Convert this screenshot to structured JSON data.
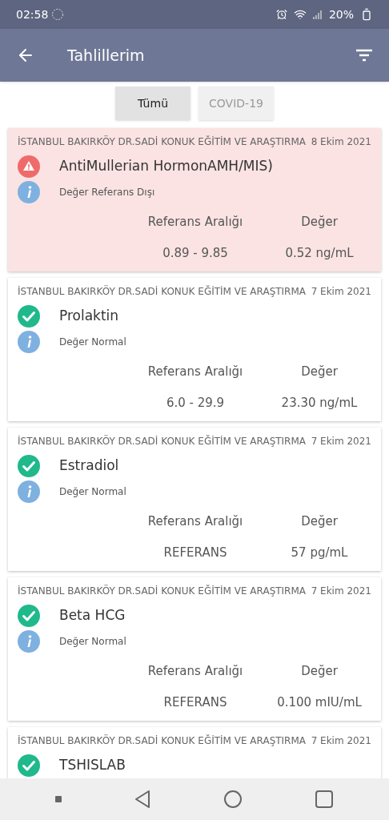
{
  "status_bar": {
    "time": "02:58",
    "battery": "20%"
  },
  "app_bar": {
    "title": "Tahlillerim"
  },
  "tabs": [
    {
      "label": "Tümü",
      "selected": true
    },
    {
      "label": "COVID-19",
      "selected": false
    }
  ],
  "results": [
    {
      "hospital": "İSTANBUL BAKIRKÖY DR.SADİ KONUK EĞİTİM VE ARAŞTIRMA",
      "date": "8 Ekim 2021",
      "test": "AntiMullerian HormonAMH/MIS)",
      "kind": "abnormal",
      "note": "Değer Referans Dışı",
      "range_label": "Referans Aralığı",
      "value_label": "Değer",
      "range": "0.89 - 9.85",
      "value": "0.52 ng/mL"
    },
    {
      "hospital": "İSTANBUL BAKIRKÖY DR.SADİ KONUK EĞİTİM VE ARAŞTIRMA",
      "date": "7 Ekim 2021",
      "test": "Prolaktin",
      "kind": "normal",
      "note": "Değer Normal",
      "range_label": "Referans Aralığı",
      "value_label": "Değer",
      "range": "6.0 - 29.9",
      "value": "23.30 ng/mL"
    },
    {
      "hospital": "İSTANBUL BAKIRKÖY DR.SADİ KONUK EĞİTİM VE ARAŞTIRMA",
      "date": "7 Ekim 2021",
      "test": "Estradiol",
      "kind": "normal",
      "note": "Değer Normal",
      "range_label": "Referans Aralığı",
      "value_label": "Değer",
      "range": "REFERANS",
      "value": "57 pg/mL"
    },
    {
      "hospital": "İSTANBUL BAKIRKÖY DR.SADİ KONUK EĞİTİM VE ARAŞTIRMA",
      "date": "7 Ekim 2021",
      "test": "Beta HCG",
      "kind": "normal",
      "note": "Değer Normal",
      "range_label": "Referans Aralığı",
      "value_label": "Değer",
      "range": "REFERANS",
      "value": "0.100 mIU/mL"
    },
    {
      "hospital": "İSTANBUL BAKIRKÖY DR.SADİ KONUK EĞİTİM VE ARAŞTIRMA",
      "date": "7 Ekim 2021",
      "test": "TSHISLAB",
      "kind": "normal"
    }
  ]
}
